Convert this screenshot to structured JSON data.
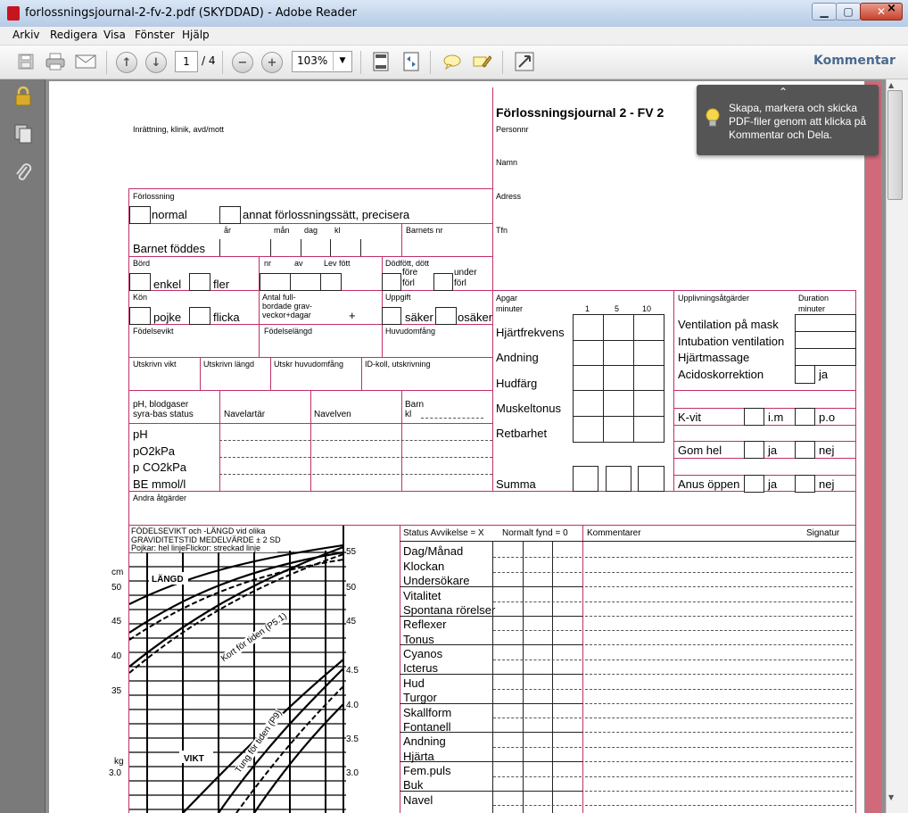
{
  "window": {
    "title": "forlossningsjournal-2-fv-2.pdf (SKYDDAD) - Adobe Reader"
  },
  "menu": {
    "items": [
      "Arkiv",
      "Redigera",
      "Visa",
      "Fönster",
      "Hjälp"
    ],
    "close_symbol": "×"
  },
  "toolbar": {
    "page_current": "1",
    "page_total": "/ 4",
    "zoom": "103%",
    "comment_label": "Kommentar"
  },
  "tooltip": {
    "chevron": "⌃",
    "text": "Skapa, markera och skicka PDF-filer genom att klicka på Kommentar och Dela."
  },
  "form": {
    "title": "Förlossningsjournal 2 - FV 2",
    "institution": "Inrättning, klinik, avd/mott",
    "right_labels": [
      "Personnr",
      "Namn",
      "Adress",
      "Tfn"
    ],
    "forlossning": "Förlossning",
    "normal": "normal",
    "annat": "annat förlossningssätt, precisera",
    "ar": "år",
    "man": "mån",
    "dag": "dag",
    "kl": "kl",
    "barnet_foddes": "Barnet föddes",
    "barnets_nr": "Barnets nr",
    "bord": "Börd",
    "nr": "nr",
    "av": "av",
    "lev_fott": "Lev fött",
    "dodfott": "Dödfött, dött",
    "enkel": "enkel",
    "fler": "fler",
    "fore": "före",
    "forl1": "förl",
    "under": "under",
    "forl2": "förl",
    "kon": "Kön",
    "antal": [
      "Antal full-",
      "bordade grav-",
      "veckor+dagar"
    ],
    "plus": "+",
    "pojke": "pojke",
    "flicka": "flicka",
    "uppgift": "Uppgift",
    "saker": "säker",
    "osaker": "osäker",
    "fodelsevikt": "Födelsevikt",
    "fodelselangd": "Födelselängd",
    "huvudomfang": "Huvudomfång",
    "utskrivn_vikt": "Utskrivn vikt",
    "utskrivn_langd": "Utskrivn längd",
    "utskr_huvud": "Utskr huvudomfång",
    "idkoll": "ID-koll, utskrivning",
    "ph_header": [
      "pH, blodgaser",
      "syra-bas status"
    ],
    "navelartar": "Navelartär",
    "navelven": "Navelven",
    "barn_kl": [
      "Barn",
      "kl"
    ],
    "blood_rows": [
      "pH",
      "pO2kPa",
      "p CO2kPa",
      "BE mmol/l"
    ],
    "andra": "Andra åtgärder",
    "apgar": [
      "Apgar",
      "minuter"
    ],
    "apgar_cols": [
      "1",
      "5",
      "10"
    ],
    "apgar_rows": [
      "Hjärtfrekvens",
      "Andning",
      "Hudfärg",
      "Muskeltonus",
      "Retbarhet"
    ],
    "summa": "Summa",
    "upplivning": "Upplivningsåtgärder",
    "duration": [
      "Duration",
      "minuter"
    ],
    "upplivning_rows": [
      "Ventilation på mask",
      "Intubation ventilation",
      "Hjärtmassage",
      "Acidoskorrektion"
    ],
    "ja": "ja",
    "nej": "nej",
    "kvit": "K-vit",
    "im": "i.m",
    "po": "p.o",
    "gom": "Gom hel",
    "anus": "Anus öppen",
    "chart_title": [
      "FÖDELSEVIKT och -LÄNGD vid olika",
      "GRAVIDITETSTID MEDELVÄRDE ± 2 SD",
      "Pojkar: hel linjeFlickor: streckad linje"
    ],
    "cm": "cm",
    "kg": "kg",
    "left_ticks": [
      "50",
      "45",
      "40",
      "35",
      "3.0"
    ],
    "right_ticks": [
      "55",
      "50",
      "45",
      "4.5",
      "4.0",
      "3.5",
      "3.0"
    ],
    "langd": "LÄNGD",
    "vikt": "VIKT",
    "kort": "Kort för tiden (P5.1)",
    "tung": "Tung för tiden (P9)",
    "status_header": "Status Avvikelse = X",
    "normalt": "Normalt fynd = 0",
    "kommentarer": "Kommentarer",
    "signatur": "Signatur",
    "status_rows": [
      "Dag/Månad",
      "Klockan",
      "Undersökare",
      "Vitalitet",
      "Spontana rörelser",
      "Reflexer",
      "Tonus",
      "Cyanos",
      "Icterus",
      "Hud",
      "Turgor",
      "Skallform",
      "Fontanell",
      "Andning",
      "Hjärta",
      "Fem.puls",
      "Buk",
      "Navel"
    ]
  }
}
